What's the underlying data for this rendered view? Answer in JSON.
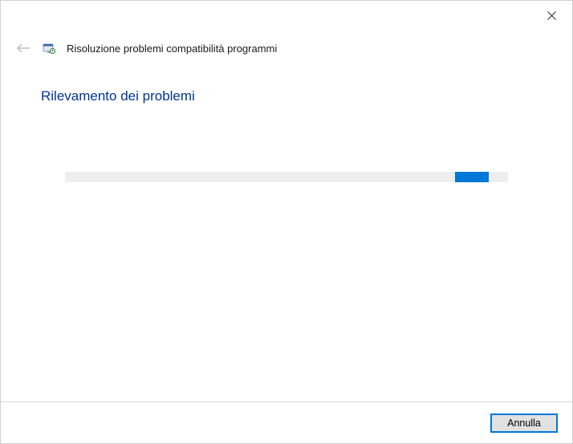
{
  "header": {
    "title": "Risoluzione problemi compatibilità programmi"
  },
  "content": {
    "heading": "Rilevamento dei problemi"
  },
  "progress": {
    "mode": "indeterminate"
  },
  "footer": {
    "cancel_label": "Annulla"
  }
}
